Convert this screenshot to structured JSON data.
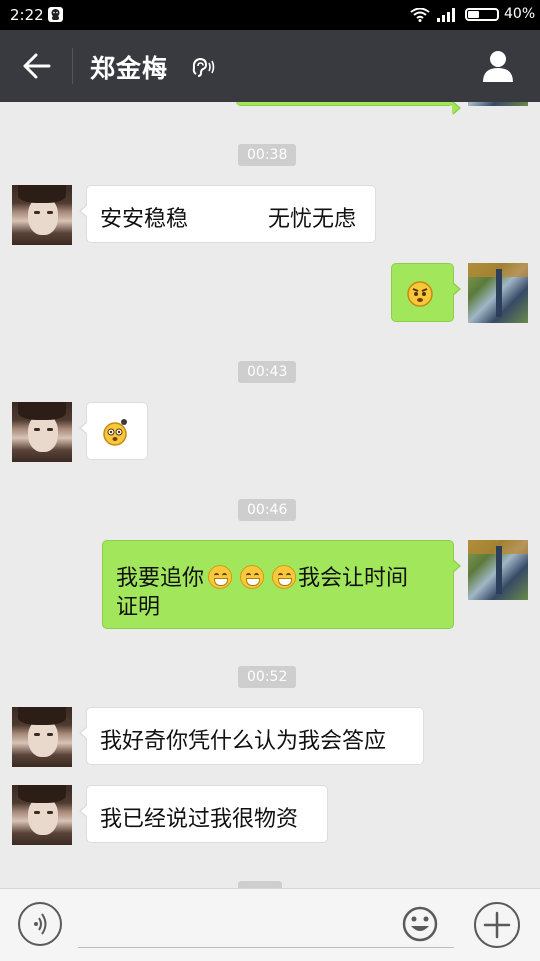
{
  "status_bar": {
    "time": "2:22",
    "battery": "40%",
    "battery_level": 0.4
  },
  "header": {
    "contact_name": "郑金梅",
    "back_icon": "back-arrow-icon",
    "earpiece_icon": "earpiece-icon",
    "profile_icon": "person-icon"
  },
  "colors": {
    "header_bg": "#393a3f",
    "chat_bg": "#ebebeb",
    "outgoing_bubble": "#a2e65b",
    "incoming_bubble": "#ffffff"
  },
  "messages": {
    "ts1": "00:38",
    "m1": {
      "left": "安安稳稳",
      "right": "无忧无虑",
      "sender": "contact"
    },
    "m2": {
      "type": "emoji",
      "emoji": "angry-face-emoji",
      "sender": "me"
    },
    "ts2": "00:43",
    "m3": {
      "type": "emoji",
      "emoji": "confused-face-emoji",
      "sender": "contact"
    },
    "ts3": "00:46",
    "m4": {
      "line1_a": "我要追你",
      "line1_b": "我会让时间",
      "line2": "证明",
      "sender": "me"
    },
    "ts4": "00:52",
    "m5": {
      "text": "我好奇你凭什么认为我会答应",
      "sender": "contact"
    },
    "m6": {
      "text": "我已经说过我很物资",
      "sender": "contact"
    }
  },
  "input_bar": {
    "placeholder": "",
    "voice_icon": "voice-icon",
    "emoji_icon": "smiley-icon",
    "plus_icon": "plus-icon"
  }
}
